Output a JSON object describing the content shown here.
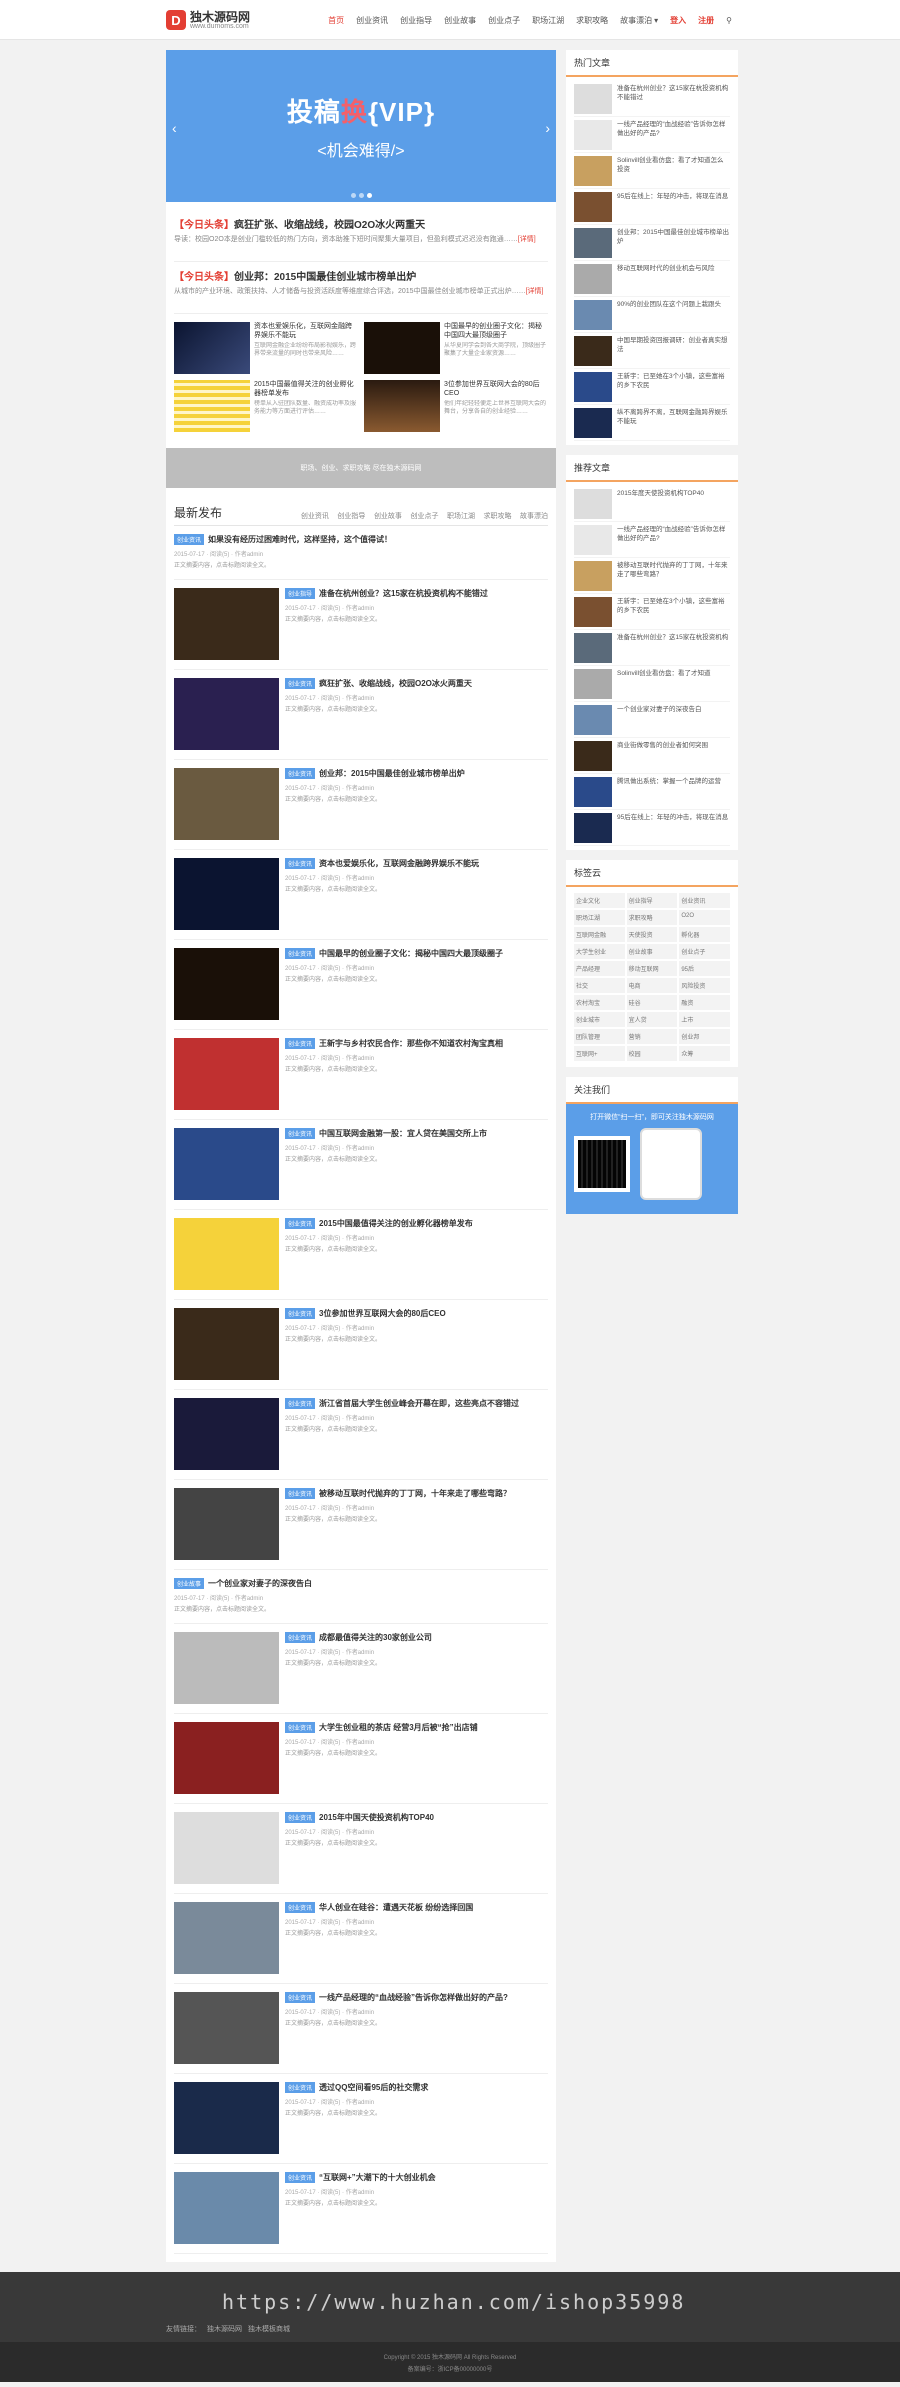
{
  "header": {
    "logo_mark": "D",
    "logo_title": "独木源码网",
    "logo_url": "www.dumoms.com",
    "nav": [
      "首页",
      "创业资讯",
      "创业指导",
      "创业故事",
      "创业点子",
      "职场江湖",
      "求职攻略",
      "故事漂泊"
    ],
    "login": "登入",
    "register": "注册"
  },
  "slider": {
    "title_a": "投稿",
    "title_hl": "换",
    "title_b": "{VIP}",
    "subtitle": "<机会难得/>"
  },
  "headlines": [
    {
      "tag": "【今日头条】",
      "title": "疯狂扩张、收缩战线，校园O2O冰火两重天",
      "excerpt": "导读：校园O2O本是创业门槛较低的热门方向，资本助推下短时间聚集大量项目，但盈利模式迟迟没有跑通……",
      "more": "[详情]"
    },
    {
      "tag": "【今日头条】",
      "title": "创业邦：2015中国最佳创业城市榜单出炉",
      "excerpt": "从城市的产业环境、政策扶持、人才储备与投资活跃度等维度综合评选，2015中国最佳创业城市榜单正式出炉……",
      "more": "[详情]"
    }
  ],
  "grid": [
    {
      "title": "资本也爱娱乐化，互联网金融跨界娱乐不能玩",
      "excerpt": "互联网金融企业纷纷布局影视娱乐，跨界带来流量的同时也带来风险……"
    },
    {
      "title": "中国最早的创业圈子文化：揭秘中国四大最顶级圈子",
      "excerpt": "从华夏同学会到各大商学院，顶级圈子聚集了大量企业家资源……"
    },
    {
      "title": "2015中国最值得关注的创业孵化器榜单发布",
      "excerpt": "榜单从入驻团队数量、融资成功率及服务能力等方面进行评估……"
    },
    {
      "title": "3位参加世界互联网大会的80后CEO",
      "excerpt": "他们年纪轻轻便走上世界互联网大会的舞台，分享各自的创业经验……"
    }
  ],
  "banner": "职场、创业、求职攻略 尽在独木源码网",
  "list": {
    "title": "最新发布",
    "tabs": [
      "创业资讯",
      "创业指导",
      "创业故事",
      "创业点子",
      "职场江湖",
      "求职攻略",
      "故事漂泊"
    ],
    "meta": "2015-07-17 · 阅读(5) · 作者admin",
    "excerpt": "正文摘要内容，点击标题阅读全文。",
    "articles": [
      {
        "badge": "创业资讯",
        "title": "如果没有经历过困难时代，这样坚持，这个值得试！",
        "text": true
      },
      {
        "badge": "创业指导",
        "title": "准备在杭州创业？这15家在杭投资机构不能错过"
      },
      {
        "badge": "创业资讯",
        "title": "疯狂扩张、收缩战线，校园O2O冰火两重天"
      },
      {
        "badge": "创业资讯",
        "title": "创业邦：2015中国最佳创业城市榜单出炉"
      },
      {
        "badge": "创业资讯",
        "title": "资本也爱娱乐化，互联网金融跨界娱乐不能玩"
      },
      {
        "badge": "创业资讯",
        "title": "中国最早的创业圈子文化：揭秘中国四大最顶级圈子"
      },
      {
        "badge": "创业资讯",
        "title": "王新宇与乡村农民合作：那些你不知道农村淘宝真相"
      },
      {
        "badge": "创业资讯",
        "title": "中国互联网金融第一股：宜人贷在美国交所上市"
      },
      {
        "badge": "创业资讯",
        "title": "2015中国最值得关注的创业孵化器榜单发布"
      },
      {
        "badge": "创业资讯",
        "title": "3位参加世界互联网大会的80后CEO"
      },
      {
        "badge": "创业资讯",
        "title": "浙江省首届大学生创业峰会开幕在即，这些亮点不容错过"
      },
      {
        "badge": "创业资讯",
        "title": "被移动互联时代抛弃的丁丁网，十年来走了哪些弯路？"
      },
      {
        "badge": "创业故事",
        "title": "一个创业家对妻子的深夜告白",
        "text": true
      },
      {
        "badge": "创业资讯",
        "title": "成都最值得关注的30家创业公司"
      },
      {
        "badge": "创业资讯",
        "title": "大学生创业租的茶店 经营3月后被“抢”出店铺"
      },
      {
        "badge": "创业资讯",
        "title": "2015年中国天使投资机构TOP40"
      },
      {
        "badge": "创业资讯",
        "title": "华人创业在硅谷：遭遇天花板 纷纷选择回国"
      },
      {
        "badge": "创业资讯",
        "title": "一线产品经理的“血战经验”告诉你怎样做出好的产品?"
      },
      {
        "badge": "创业资讯",
        "title": "透过QQ空间看95后的社交需求"
      },
      {
        "badge": "创业资讯",
        "title": "“互联网+”大潮下的十大创业机会"
      }
    ]
  },
  "side": {
    "hot_title": "热门文章",
    "hot": [
      "准备在杭州创业？这15家在杭投资机构不能错过",
      "一线产品经理的“血战经验”告诉你怎样做出好的产品?",
      "Solinvill创业看仿盘：看了才知道怎么投资",
      "95后在线上：年轻的冲击，将现在消息",
      "创业邦：2015中国最佳创业城市榜单出炉",
      "移动互联网时代的创业机会与风险",
      "90%的创业团队在这个问题上栽跟头",
      "中国早期投资回报调研：创业者真实想法",
      "王新宇：已至她在3个小镇，这些富裕的乡下农民",
      "纵不离跨界不离，互联网金融跨界娱乐不能玩"
    ],
    "rec_title": "推荐文章",
    "rec": [
      "2015年度天使投资机构TOP40",
      "一线产品经理的“血战经验”告诉你怎样做出好的产品?",
      "被移动互联时代抛弃的丁丁网，十年来走了哪些弯路？",
      "王新宇：已至她在3个小镇，这些富裕的乡下农民",
      "准备在杭州创业？这15家在杭投资机构",
      "Solinvill创业看仿盘：看了才知道",
      "一个创业家对妻子的深夜告白",
      "商业街做零售的创业者如何突围",
      "腾讯做出系统：掌握一个品牌的运营",
      "95后在线上：年轻的冲击，将现在消息"
    ],
    "tags_title": "标签云",
    "tags": [
      "企业文化",
      "创业指导",
      "创业资讯",
      "职场江湖",
      "求职攻略",
      "O2O",
      "互联网金融",
      "天使投资",
      "孵化器",
      "大学生创业",
      "创业故事",
      "创业点子",
      "产品经理",
      "移动互联网",
      "95后",
      "社交",
      "电商",
      "风险投资",
      "农村淘宝",
      "硅谷",
      "融资",
      "创业城市",
      "宜人贷",
      "上市",
      "团队管理",
      "营销",
      "创业邦",
      "互联网+",
      "校园",
      "众筹"
    ],
    "follow_title": "关注我们",
    "follow_text": "打开微信“扫一扫”，即可关注独木源码网"
  },
  "footer": {
    "links_label": "友情链接：",
    "links": [
      "独木源码网",
      "独木模板商城"
    ],
    "copyright": "Copyright © 2015 独木源码网 All Rights Reserved",
    "icp": "备案编号：浙ICP备00000000号"
  },
  "watermark": "https://www.huzhan.com/ishop35998",
  "colors": {
    "accent": "#e33e33",
    "blue": "#5b9ee8"
  }
}
